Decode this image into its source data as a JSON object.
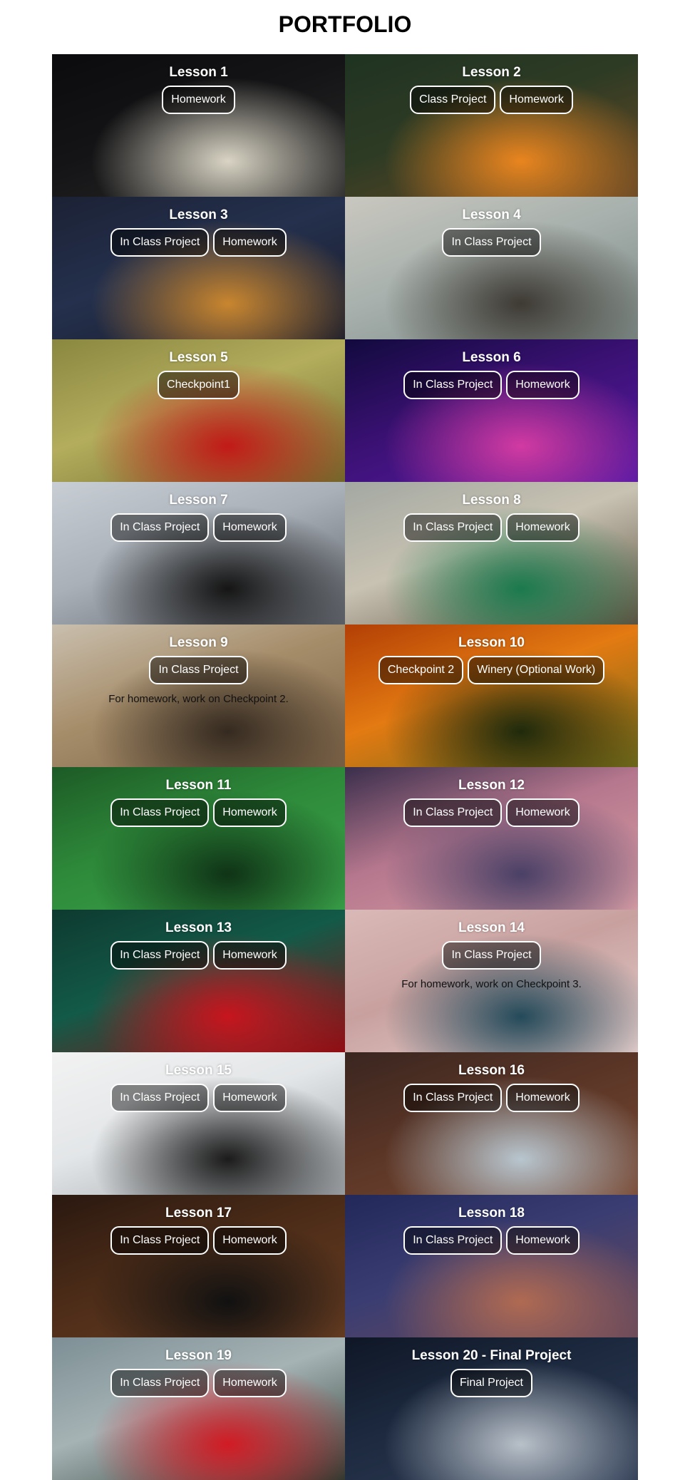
{
  "page_title": "PORTFOLIO",
  "tiles": [
    {
      "title": "Lesson 1",
      "buttons": [
        "Homework"
      ],
      "note": "",
      "colors": [
        "#0b0b0d",
        "#141416",
        "#2a2a2a",
        "#d9d4c4"
      ]
    },
    {
      "title": "Lesson 2",
      "buttons": [
        "Class Project",
        "Homework"
      ],
      "note": "",
      "colors": [
        "#1f3322",
        "#2e3b24",
        "#6b4a26",
        "#e9851f"
      ]
    },
    {
      "title": "Lesson 3",
      "buttons": [
        "In Class Project",
        "Homework"
      ],
      "note": "",
      "colors": [
        "#1c2235",
        "#24304d",
        "#1a1c2a",
        "#c9862f"
      ]
    },
    {
      "title": "Lesson 4",
      "buttons": [
        "In Class Project"
      ],
      "note": "",
      "colors": [
        "#c9c7bf",
        "#a8b1ad",
        "#7a8682",
        "#3e3a34"
      ]
    },
    {
      "title": "Lesson 5",
      "buttons": [
        "Checkpoint1"
      ],
      "note": "",
      "colors": [
        "#8a8740",
        "#b3ad5d",
        "#6e6b2a",
        "#c21a17"
      ]
    },
    {
      "title": "Lesson 6",
      "buttons": [
        "In Class Project",
        "Homework"
      ],
      "note": "",
      "colors": [
        "#120a3e",
        "#3a1173",
        "#5a1aa6",
        "#d23aa2"
      ]
    },
    {
      "title": "Lesson 7",
      "buttons": [
        "In Class Project",
        "Homework"
      ],
      "note": "",
      "colors": [
        "#c8ced4",
        "#a9b0b8",
        "#5d6168",
        "#151515"
      ]
    },
    {
      "title": "Lesson 8",
      "buttons": [
        "In Class Project",
        "Homework"
      ],
      "note": "",
      "colors": [
        "#a3a8a2",
        "#c8c2b2",
        "#5c4f3e",
        "#1b7a4d"
      ]
    },
    {
      "title": "Lesson 9",
      "buttons": [
        "In Class Project"
      ],
      "note": "For homework, work on Checkpoint 2.",
      "colors": [
        "#c9bfae",
        "#a68d6a",
        "#7a6145",
        "#352a20"
      ]
    },
    {
      "title": "Lesson 10",
      "buttons": [
        "Checkpoint 2",
        "Winery (Optional Work)"
      ],
      "note": "",
      "colors": [
        "#b33f05",
        "#e37a12",
        "#6e6a1a",
        "#1f2a0c"
      ]
    },
    {
      "title": "Lesson 11",
      "buttons": [
        "In Class Project",
        "Homework"
      ],
      "note": "",
      "colors": [
        "#1d5a26",
        "#2e8a3a",
        "#3aa34a",
        "#0f3316"
      ]
    },
    {
      "title": "Lesson 12",
      "buttons": [
        "In Class Project",
        "Homework"
      ],
      "note": "",
      "colors": [
        "#3a2e4c",
        "#b5778d",
        "#d99fa6",
        "#4a4066"
      ]
    },
    {
      "title": "Lesson 13",
      "buttons": [
        "In Class Project",
        "Homework"
      ],
      "note": "",
      "colors": [
        "#0e3a30",
        "#135a48",
        "#8c0c12",
        "#c7151e"
      ]
    },
    {
      "title": "Lesson 14",
      "buttons": [
        "In Class Project"
      ],
      "note": "For homework, work on Checkpoint 3.",
      "colors": [
        "#d9b9b7",
        "#c8a19f",
        "#e6cfcd",
        "#244a5a"
      ]
    },
    {
      "title": "Lesson 15",
      "buttons": [
        "In Class Project",
        "Homework"
      ],
      "note": "",
      "colors": [
        "#f2f2f2",
        "#e3e6e8",
        "#9da2a6",
        "#1b1b1b"
      ]
    },
    {
      "title": "Lesson 16",
      "buttons": [
        "In Class Project",
        "Homework"
      ],
      "note": "",
      "colors": [
        "#3a2620",
        "#5a3526",
        "#7a4a34",
        "#b8c6cf"
      ]
    },
    {
      "title": "Lesson 17",
      "buttons": [
        "In Class Project",
        "Homework"
      ],
      "note": "",
      "colors": [
        "#2a1810",
        "#4c2c18",
        "#6a3e22",
        "#111111"
      ]
    },
    {
      "title": "Lesson 18",
      "buttons": [
        "In Class Project",
        "Homework"
      ],
      "note": "",
      "colors": [
        "#22285a",
        "#3a3d72",
        "#6b4a5a",
        "#b06a52"
      ]
    },
    {
      "title": "Lesson 19",
      "buttons": [
        "In Class Project",
        "Homework"
      ],
      "note": "",
      "colors": [
        "#7d8f95",
        "#a6b3b5",
        "#2a3a30",
        "#d21b24"
      ]
    },
    {
      "title": "Lesson 20 - Final Project",
      "buttons": [
        "Final Project"
      ],
      "note": "",
      "colors": [
        "#0f1726",
        "#1d2a40",
        "#2f3d55",
        "#b8c0c8"
      ]
    }
  ]
}
